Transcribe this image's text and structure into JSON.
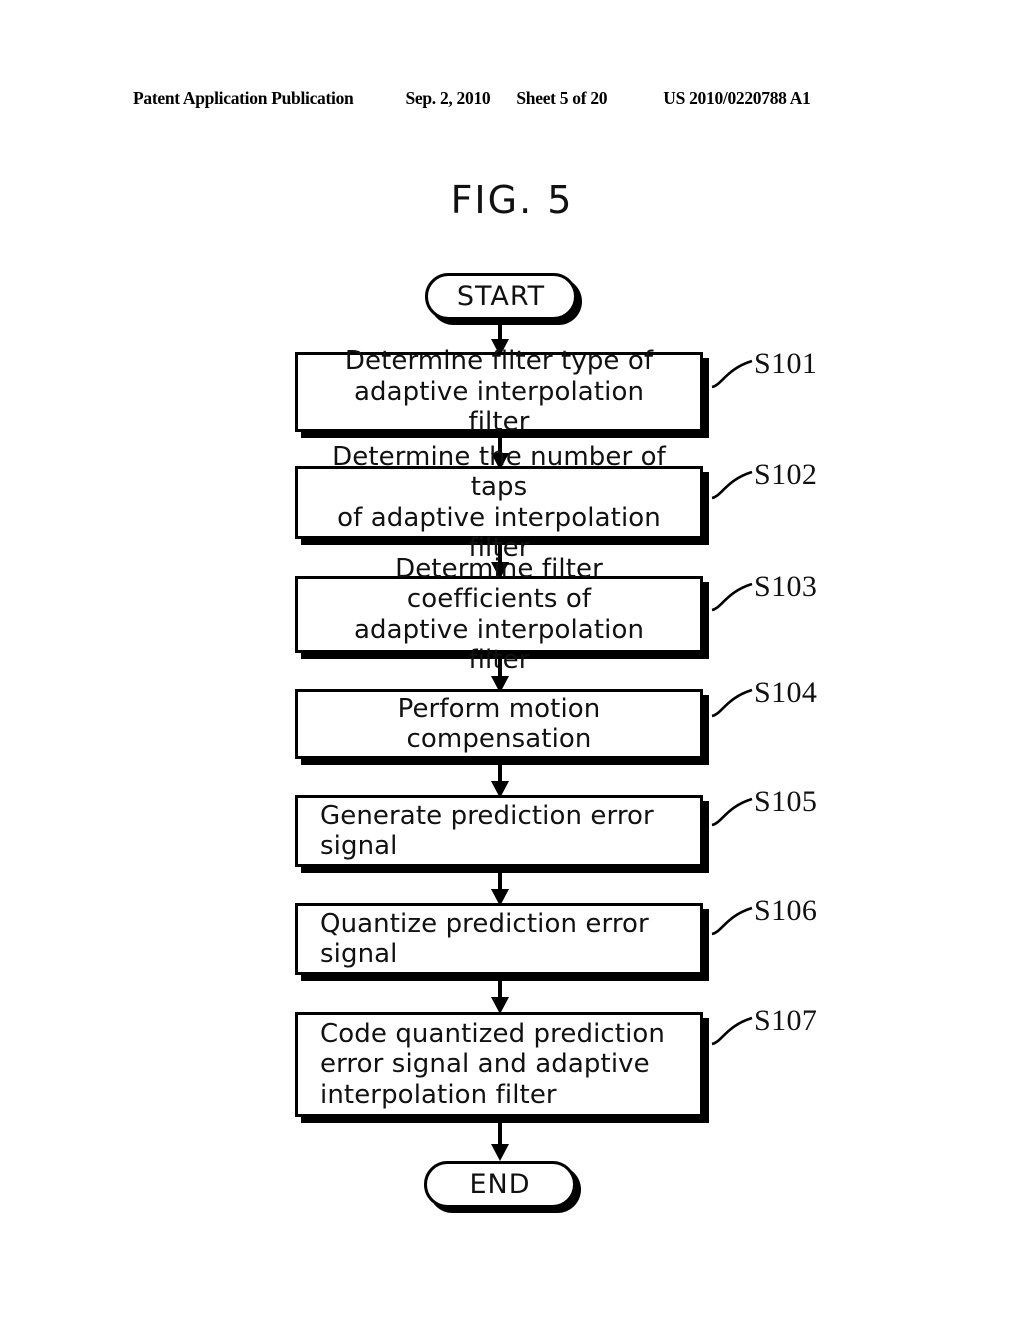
{
  "header": {
    "publication": "Patent Application Publication",
    "date": "Sep. 2, 2010",
    "sheet": "Sheet 5 of 20",
    "patent_number": "US 2010/0220788 A1"
  },
  "figure": {
    "title": "FIG. 5"
  },
  "flowchart": {
    "start_label": "START",
    "end_label": "END",
    "steps": [
      {
        "id": "S101",
        "text": "Determine filter type of\nadaptive interpolation filter",
        "align": "center"
      },
      {
        "id": "S102",
        "text": "Determine the number of taps\nof adaptive interpolation filter",
        "align": "center"
      },
      {
        "id": "S103",
        "text": "Determine filter coefficients of\nadaptive interpolation filter",
        "align": "center"
      },
      {
        "id": "S104",
        "text": "Perform motion compensation",
        "align": "center"
      },
      {
        "id": "S105",
        "text": "Generate prediction error\nsignal",
        "align": "lead"
      },
      {
        "id": "S106",
        "text": "Quantize prediction error\nsignal",
        "align": "lead"
      },
      {
        "id": "S107",
        "text": "Code quantized prediction\nerror signal and adaptive\ninterpolation filter",
        "align": "lead"
      }
    ]
  },
  "colors": {
    "ink": "#000000",
    "paper": "#ffffff"
  }
}
